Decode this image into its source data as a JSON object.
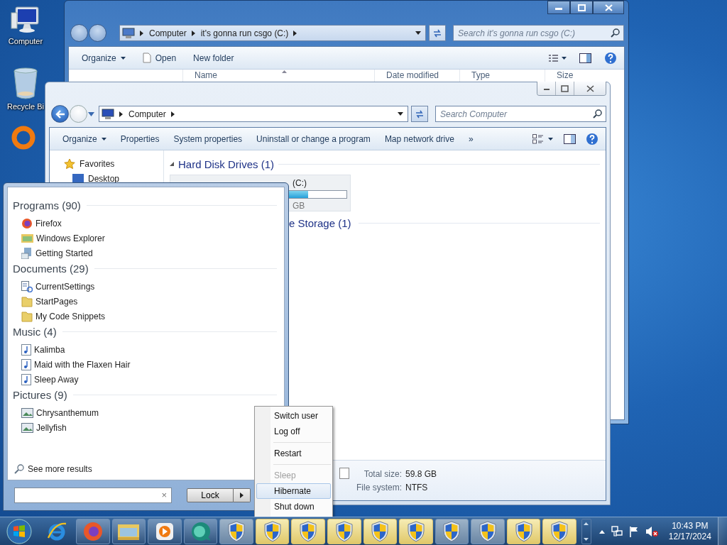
{
  "desktop_icons": [
    {
      "label": "Computer",
      "kind": "computer"
    },
    {
      "label": "Recycle Bi",
      "kind": "recycle"
    }
  ],
  "back_window": {
    "breadcrumbs": [
      "Computer",
      "it's gonna run csgo (C:)"
    ],
    "search": {
      "placeholder": "Search it's gonna run csgo (C:)"
    },
    "toolbar": [
      {
        "label": "Organize",
        "kind": "menu"
      },
      {
        "label": "Open",
        "kind": "file"
      },
      {
        "label": "New folder",
        "kind": "plain"
      }
    ],
    "columns": [
      "Name",
      "Date modified",
      "Type",
      "Size"
    ]
  },
  "front_window": {
    "breadcrumbs": [
      "Computer"
    ],
    "search": {
      "placeholder": "Search Computer"
    },
    "toolbar": [
      {
        "label": "Organize",
        "kind": "menu"
      },
      {
        "label": "Properties",
        "kind": "plain"
      },
      {
        "label": "System properties",
        "kind": "plain"
      },
      {
        "label": "Uninstall or change a program",
        "kind": "plain"
      },
      {
        "label": "Map network drive",
        "kind": "plain"
      },
      {
        "label": "»",
        "kind": "plain"
      }
    ],
    "nav": [
      {
        "label": "Favorites",
        "kind": "star"
      },
      {
        "label": "Desktop",
        "kind": "desktop"
      }
    ],
    "groups": [
      {
        "title": "Hard Disk Drives (1)",
        "expanded": true
      },
      {
        "title": "e Storage (1)"
      }
    ],
    "drive": {
      "name": "(C:)",
      "level": 0.72,
      "free": "GB"
    },
    "details": [
      {
        "label": "Total size:",
        "value": "59.8 GB"
      },
      {
        "label": "File system:",
        "value": "NTFS"
      }
    ]
  },
  "start_menu": {
    "sections": [
      {
        "title": "Programs (90)",
        "items": [
          {
            "label": "Firefox",
            "kind": "firefox"
          },
          {
            "label": "Windows Explorer",
            "kind": "explorer"
          },
          {
            "label": "Getting Started",
            "kind": "document"
          }
        ]
      },
      {
        "title": "Documents (29)",
        "items": [
          {
            "label": "CurrentSettings",
            "kind": "settings"
          },
          {
            "label": "StartPages",
            "kind": "folder"
          },
          {
            "label": "My Code Snippets",
            "kind": "folder"
          }
        ]
      },
      {
        "title": "Music (4)",
        "items": [
          {
            "label": "Kalimba",
            "kind": "music"
          },
          {
            "label": "Maid with the Flaxen Hair",
            "kind": "music"
          },
          {
            "label": "Sleep Away",
            "kind": "music"
          }
        ]
      },
      {
        "title": "Pictures (9)",
        "items": [
          {
            "label": "Chrysanthemum",
            "kind": "picture"
          },
          {
            "label": "Jellyfish",
            "kind": "picture"
          }
        ]
      }
    ],
    "see_more": "See more results",
    "search_clear": "×",
    "lock_button": "Lock"
  },
  "power_menu": {
    "groups": [
      [
        {
          "label": "Switch user",
          "disabled": false,
          "selected": false
        },
        {
          "label": "Log off",
          "disabled": false,
          "selected": false
        }
      ],
      [
        {
          "label": "Restart",
          "disabled": false,
          "selected": false
        }
      ],
      [
        {
          "label": "Sleep",
          "disabled": true,
          "selected": false
        },
        {
          "label": "Hibernate",
          "disabled": false,
          "selected": true
        },
        {
          "label": "Shut down",
          "disabled": false,
          "selected": false
        }
      ]
    ]
  },
  "taskbar": {
    "pinned": [
      {
        "kind": "ie"
      },
      {
        "kind": "firefox"
      },
      {
        "kind": "explorer"
      },
      {
        "kind": "media"
      },
      {
        "kind": "green"
      }
    ],
    "shields": [
      {
        "flashing": false
      },
      {
        "flashing": true
      },
      {
        "flashing": true
      },
      {
        "flashing": true
      },
      {
        "flashing": true
      },
      {
        "flashing": true
      },
      {
        "flashing": false
      },
      {
        "flashing": false
      },
      {
        "flashing": true
      },
      {
        "flashing": true
      }
    ],
    "clock": {
      "time": "10:43 PM",
      "date": "12/17/2024"
    }
  }
}
